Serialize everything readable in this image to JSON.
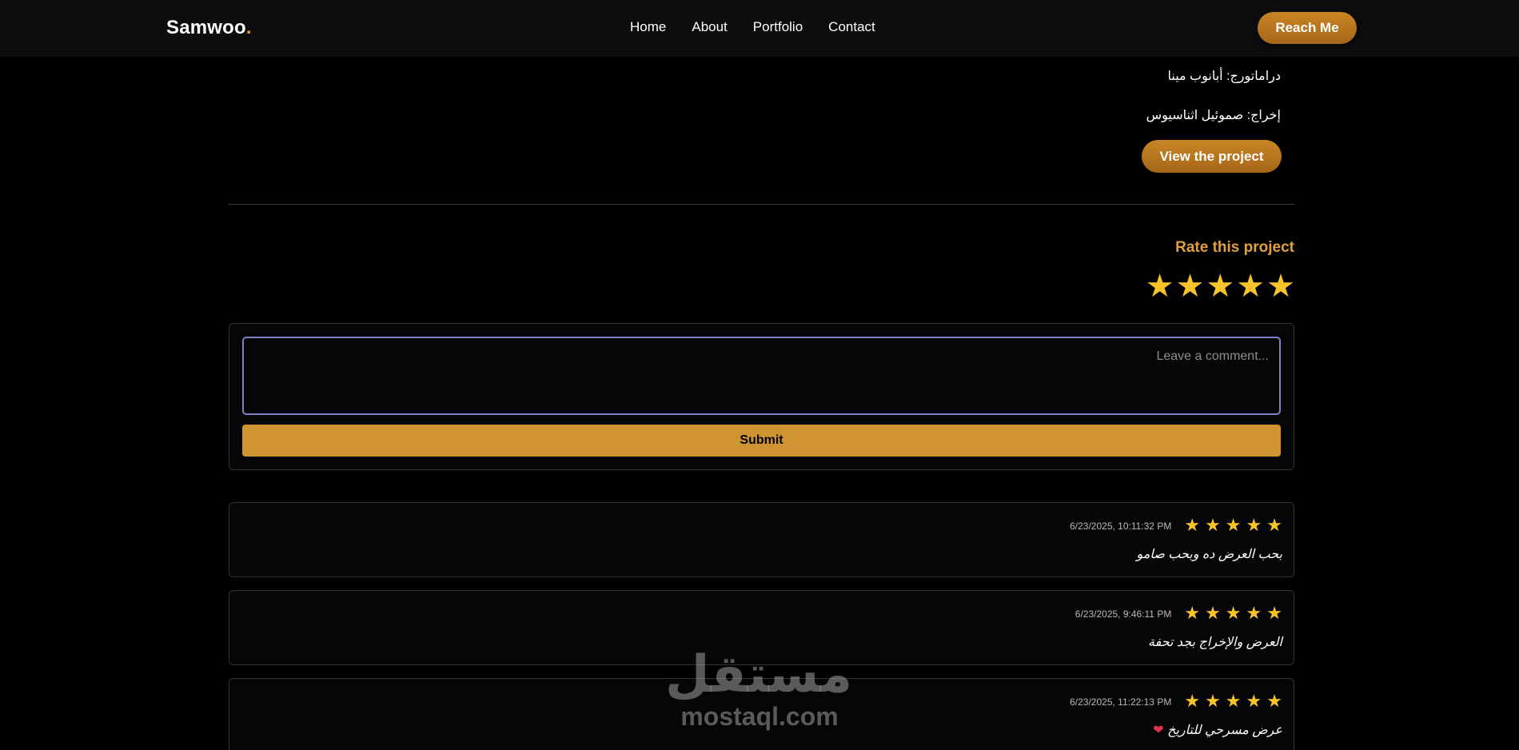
{
  "navbar": {
    "brand": "Samwoo",
    "brand_dot": ".",
    "links": [
      "Home",
      "About",
      "Portfolio",
      "Contact"
    ],
    "cta_label": "Reach Me"
  },
  "project": {
    "dramaturg": "دراماتورج: أبانوب مينا",
    "director": "إخراج: صموئيل اثناسيوس",
    "view_label": "View the project"
  },
  "rating": {
    "title": "Rate this project",
    "stars": "★★★★★",
    "value": 5,
    "max": 5
  },
  "comment_form": {
    "placeholder": "...Leave a comment",
    "submit_label": "Submit"
  },
  "reviews": [
    {
      "stars": "★★★★★",
      "rating": 5,
      "date": "6/23/2025, 10:11:32 PM",
      "text": "بحب العرض ده وبحب صامو",
      "emoji": ""
    },
    {
      "stars": "★★★★★",
      "rating": 5,
      "date": "6/23/2025, 9:46:11 PM",
      "text": "العرض والإخراج بجد تحفة",
      "emoji": ""
    },
    {
      "stars": "★★★★★",
      "rating": 5,
      "date": "6/23/2025, 11:22:13 PM",
      "text": "عرض مسرحي للتاريخ",
      "emoji": "❤"
    }
  ],
  "watermark": {
    "arabic": "مستقل",
    "latin": "mostaql.com"
  },
  "colors": {
    "accent": "#cd9431",
    "star": "#f7c52b",
    "rate_title": "#e1a03d",
    "heart": "#e8324b"
  }
}
